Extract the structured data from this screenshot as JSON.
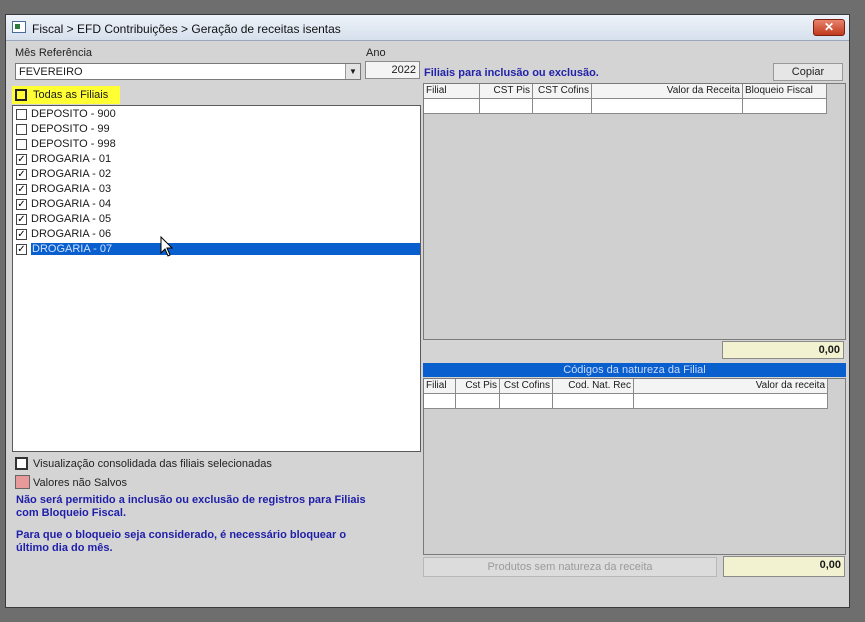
{
  "window": {
    "title": "Fiscal > EFD Contribuições > Geração de receitas isentas",
    "close_label": "✕"
  },
  "mes_referencia": {
    "label": "Mês Referência",
    "value": "FEVEREIRO"
  },
  "ano": {
    "label": "Ano",
    "value": "2022"
  },
  "todas_filiais": {
    "label": "Todas as Filiais",
    "checked": false
  },
  "filiais": [
    {
      "label": "DEPOSITO - 900",
      "checked": false,
      "selected": false
    },
    {
      "label": "DEPOSITO - 99",
      "checked": false,
      "selected": false
    },
    {
      "label": "DEPOSITO - 998",
      "checked": false,
      "selected": false
    },
    {
      "label": "DROGARIA - 01",
      "checked": true,
      "selected": false
    },
    {
      "label": "DROGARIA - 02",
      "checked": true,
      "selected": false
    },
    {
      "label": "DROGARIA - 03",
      "checked": true,
      "selected": false
    },
    {
      "label": "DROGARIA - 04",
      "checked": true,
      "selected": false
    },
    {
      "label": "DROGARIA - 05",
      "checked": true,
      "selected": false
    },
    {
      "label": "DROGARIA - 06",
      "checked": true,
      "selected": false
    },
    {
      "label": "DROGARIA - 07",
      "checked": true,
      "selected": true
    }
  ],
  "filiais_grid": {
    "title": "Filiais para inclusão ou exclusão.",
    "copy_label": "Copiar",
    "columns": [
      "Filial",
      "CST Pis",
      "CST Cofins",
      "Valor da Receita",
      "Bloqueio Fiscal"
    ],
    "total": "0,00"
  },
  "natureza_grid": {
    "title": "Códigos da natureza  da Filial",
    "columns": [
      "Filial",
      "Cst Pis",
      "Cst Cofins",
      "Cod. Nat. Rec",
      "Valor da receita"
    ],
    "total": "0,00",
    "produtos_label": "Produtos sem natureza  da receita"
  },
  "visualizacao": {
    "label": "Visualização consolidada das filiais selecionadas",
    "checked": false
  },
  "valores_nao_salvos": {
    "label": "Valores não Salvos",
    "color": "#e89a9a"
  },
  "info": {
    "line1": "Não será permitido a inclusão ou exclusão de registros para Filiais com Bloqueio Fiscal.",
    "line2": "Para que o bloqueio seja considerado, é necessário bloquear o último dia do mês."
  },
  "colors": {
    "selection": "#0a5fcf",
    "highlight": "#ffff33",
    "info_text": "#1e1eaa",
    "total_bg": "#f2f2d0"
  }
}
